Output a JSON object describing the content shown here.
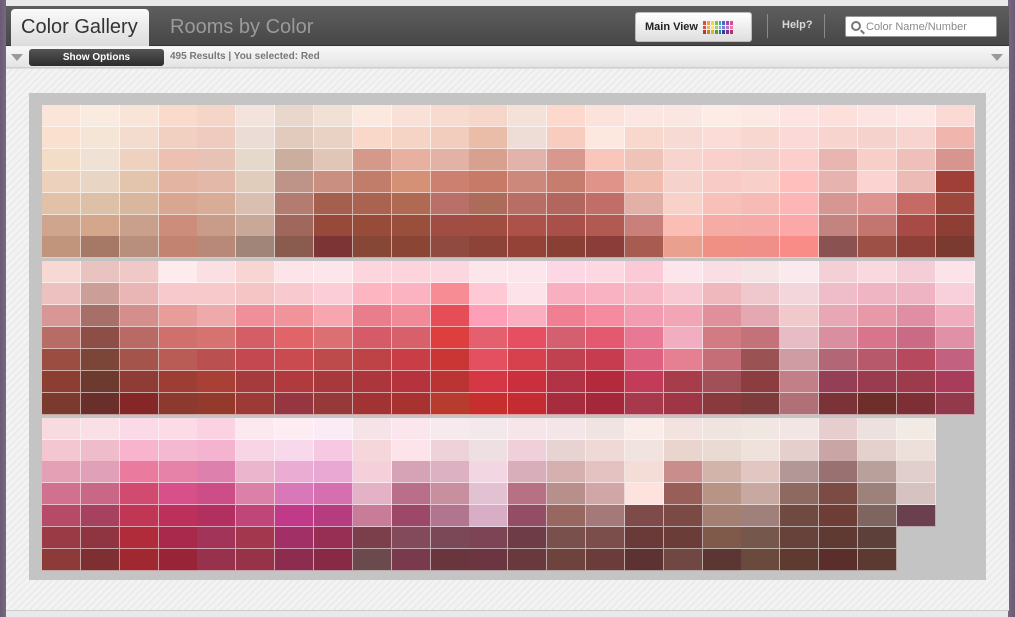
{
  "header": {
    "tabs": [
      {
        "label": "Color Gallery",
        "active": true
      },
      {
        "label": "Rooms by Color",
        "active": false
      }
    ],
    "main_view_label": "Main View",
    "help_label": "Help?",
    "search": {
      "value": "",
      "placeholder": "Color Name/Number"
    }
  },
  "options_bar": {
    "show_options_label": "Show Options",
    "status": "495 Results | You selected: Red"
  },
  "palette_icon_colors": [
    "#e8463a",
    "#f0a23a",
    "#f2d63c",
    "#7cc442",
    "#3aa0d8",
    "#5a5fc4",
    "#a04ab8",
    "#e04c8a",
    "#d8543a",
    "#e8b86a",
    "#f4e47a",
    "#9ad07a",
    "#6ab8e0",
    "#7a7ed0",
    "#b874c8",
    "#e87aa8",
    "#b83a2a",
    "#c8822a",
    "#d4b82a",
    "#5a9a32",
    "#2a78a8",
    "#3a3e94",
    "#783290",
    "#b03468"
  ],
  "swatch_groups": [
    {
      "rows": [
        [
          "#fbe4d8",
          "#f9ebdf",
          "#f8e5d8",
          "#f9dacb",
          "#f6d5c9",
          "#f2e3dc",
          "#e9d7cc",
          "#f0e0d5",
          "#fbe8df",
          "#fae1d8",
          "#f8dbcf",
          "#f5d6c9",
          "#f4e2d9",
          "#fdd8cc",
          "#fbe3dc",
          "#fbe6e1",
          "#fbe7e2",
          "#fdebe5",
          "#fce9e3",
          "#fde3e1",
          "#fde0dc",
          "#fbe4e1",
          "#fde7e4",
          "#fbdad5"
        ],
        [
          "#f9e0cf",
          "#f5e5d6",
          "#f3dccd",
          "#f2d0c1",
          "#efcbbf",
          "#ebddd5",
          "#e2cabc",
          "#e9d1c4",
          "#f9d8ca",
          "#f5d3c5",
          "#f2cdbd",
          "#e9bda8",
          "#eeddd6",
          "#f8ccbe",
          "#fde8e0",
          "#f8d8cc",
          "#f7dad3",
          "#fbdcd6",
          "#f8d7d0",
          "#fbd9d6",
          "#f8d4cf",
          "#f5d2cc",
          "#f8d4d0",
          "#f0b6ae"
        ],
        [
          "#f4ddc6",
          "#efe2d4",
          "#eed1be",
          "#ecc1b1",
          "#e9c2b6",
          "#e5d9cc",
          "#ccae9f",
          "#e1c5b6",
          "#d4998a",
          "#e7b0a0",
          "#e2b2a6",
          "#d7a08f",
          "#e2b3aa",
          "#d8988d",
          "#fac6bc",
          "#efc3b7",
          "#f8d4ce",
          "#f9d0cc",
          "#f5cfc9",
          "#fccfcc",
          "#e9b5b0",
          "#f8cec9",
          "#efc0b9",
          "#d89590"
        ],
        [
          "#ecd2bc",
          "#e9d5c3",
          "#e3c4ad",
          "#e4b4a3",
          "#e3b8a8",
          "#e0cdbb",
          "#bf9488",
          "#c98f80",
          "#c27d6a",
          "#d49176",
          "#cb8070",
          "#c77a67",
          "#cc897b",
          "#c77d6e",
          "#e09388",
          "#f0bcae",
          "#f5d2cb",
          "#f9cbc7",
          "#f8cfc9",
          "#ffbfbd",
          "#e7b3ae",
          "#fbd3d0",
          "#edbbb5",
          "#a03f38"
        ],
        [
          "#e2c1a9",
          "#dcc0a8",
          "#d9b79f",
          "#d9a691",
          "#d9ac98",
          "#d8bfaf",
          "#b37c70",
          "#a55f4e",
          "#a96350",
          "#b06952",
          "#b87068",
          "#ad6b5a",
          "#b86e65",
          "#b2665e",
          "#c06e67",
          "#e2b0a6",
          "#f8d2c8",
          "#f7c0b9",
          "#f7bbb6",
          "#fcb6b5",
          "#d69691",
          "#dd938f",
          "#c56a64",
          "#9d463c"
        ],
        [
          "#cfa58d",
          "#d4a78d",
          "#c9a08c",
          "#cc8e7a",
          "#c99c8a",
          "#c8a898",
          "#a0685c",
          "#974a3a",
          "#974c3a",
          "#9a4e3c",
          "#a04e44",
          "#a14d41",
          "#ac5248",
          "#aa504a",
          "#b05a52",
          "#c9807a",
          "#fbbeb5",
          "#f5aca5",
          "#f6aaa6",
          "#fca8a8",
          "#c3837f",
          "#c3756f",
          "#a84a46",
          "#8f3e35"
        ],
        [
          "#c0957c",
          "#a67966",
          "#b88e7c",
          "#c28371",
          "#b88879",
          "#a18578",
          "#8a5c4f",
          "#7c3534",
          "#864737",
          "#8a4535",
          "#914a3f",
          "#8e4338",
          "#944238",
          "#8a3f35",
          "#8b3d3a",
          "#a85b50",
          "#eaa08f",
          "#f08f84",
          "#f08f88",
          "#fa8c88",
          "#8b5252",
          "#9d5046",
          "#8e3f38",
          "#7a3a30"
        ]
      ],
      "skip": []
    },
    {
      "rows": [
        [
          "#f7d8d5",
          "#e9c3bf",
          "#f0c8c8",
          "#fdebee",
          "#fae0e2",
          "#f8d4d3",
          "#fde4e8",
          "#fce6ec",
          "#fdd5dc",
          "#fdd3dc",
          "#fdd7e0",
          "#fde5ec",
          "#fce6ec",
          "#fdd7e3",
          "#fdd7e1",
          "#fcc9d7",
          "#fce6ec",
          "#f9dfe3",
          "#f6e3e5",
          "#fae9ed",
          "#f5cfd6",
          "#f9d9df",
          "#f5cdd6",
          "#fbe3e9"
        ],
        [
          "#ecc1bf",
          "#cb9e98",
          "#e9b6b5",
          "#f8c9cc",
          "#f7c9ca",
          "#f5c4c4",
          "#f9c9d0",
          "#fbcdd7",
          "#fcb5c1",
          "#fbb2c1",
          "#f88c94",
          "#fec8d4",
          "#fde3e9",
          "#f8b0c0",
          "#f9b2c1",
          "#f8b9c7",
          "#f9c9d3",
          "#eeb8bc",
          "#efc8ce",
          "#f2d6db",
          "#efbcca",
          "#f0b5c3",
          "#efb4c4",
          "#f7d0dc"
        ],
        [
          "#d89794",
          "#a67068",
          "#d48f8c",
          "#e89d9b",
          "#eea9aa",
          "#f08f99",
          "#f0939a",
          "#f7a5ae",
          "#ea7d8b",
          "#f08a97",
          "#e64e57",
          "#ff9fb7",
          "#fbaec0",
          "#f07f91",
          "#f48b9e",
          "#f39bb0",
          "#f2a6b5",
          "#e0909b",
          "#e4a8b2",
          "#f1c8cb",
          "#e7a7b5",
          "#e899a8",
          "#e08ea3",
          "#f0adbd"
        ],
        [
          "#b86c66",
          "#8c4e46",
          "#b96a64",
          "#d0706d",
          "#d67371",
          "#d45e65",
          "#e16468",
          "#db6f72",
          "#d65b68",
          "#d8606b",
          "#dc3f3e",
          "#e4606e",
          "#e64f62",
          "#d45f6e",
          "#e35970",
          "#e87893",
          "#f0aec0",
          "#d27b83",
          "#c37279",
          "#e7bcc4",
          "#da8fa0",
          "#d8758c",
          "#cb6a84",
          "#e191a7"
        ],
        [
          "#9a4d40",
          "#7b4537",
          "#a4544b",
          "#b85c55",
          "#ba5050",
          "#c4484f",
          "#c94a4f",
          "#be4b4c",
          "#be4346",
          "#c93e46",
          "#ca3633",
          "#e4505f",
          "#d7404d",
          "#c04150",
          "#c73c4e",
          "#de6280",
          "#e58093",
          "#c56e78",
          "#9a5253",
          "#cf9ca3",
          "#b26676",
          "#b7596b",
          "#b7495f",
          "#c26180"
        ],
        [
          "#8c3e33",
          "#6d3a30",
          "#8f3c36",
          "#9d3e35",
          "#a84036",
          "#a63b3d",
          "#b03a3e",
          "#a7393d",
          "#ab373c",
          "#b5333d",
          "#bb3434",
          "#d53844",
          "#c92f3d",
          "#b33346",
          "#b22a3c",
          "#c23c5a",
          "#a73c4a",
          "#a25057",
          "#8b3d40",
          "#c37f88",
          "#953f56",
          "#993c50",
          "#9b3b4b",
          "#a93c5a"
        ],
        [
          "#7a3a2d",
          "#6a2f2a",
          "#862727",
          "#8c3a30",
          "#943a2d",
          "#9c3a37",
          "#963640",
          "#953a38",
          "#a23335",
          "#a73230",
          "#b73c2e",
          "#c72e2e",
          "#c42c31",
          "#a72c3e",
          "#a4283a",
          "#a8384c",
          "#9e3645",
          "#8a3a3d",
          "#7e3b3c",
          "#b07078",
          "#7b3338",
          "#6e2f2b",
          "#7e2f35",
          "#93394c"
        ]
      ],
      "skip": []
    },
    {
      "rows": [
        [
          "#f7dbe0",
          "#f8e0e6",
          "#fbd9e6",
          "#fcdbe6",
          "#fbd2e2",
          "#fbe9ef",
          "#fdecf2",
          "#fbebf4",
          "#f6e3e8",
          "#fbe6ed",
          "#f7eaee",
          "#f3e9ec",
          "#f6e6ea",
          "#f4e6e8",
          "#f0e4e2",
          "#f9ece9",
          "#f2e3e0",
          "#efe4df",
          "#f0e7e3",
          "#f2e6e4",
          "#e5cecd",
          "#ece1df",
          "#f2eae5"
        ],
        [
          "#f4c6d2",
          "#efbccc",
          "#f8b3cd",
          "#f5b8d1",
          "#f4b4d0",
          "#f7d5e4",
          "#f8d8eb",
          "#f6c8e2",
          "#f4d6db",
          "#fde4ea",
          "#eed2d9",
          "#eedfe3",
          "#efd0da",
          "#e8d3d3",
          "#efd9d7",
          "#f1e4e0",
          "#e9d5ce",
          "#e9dad3",
          "#efe2dc",
          "#e5cfcc",
          "#c9a5a5",
          "#e4d1cd",
          "#ede0da"
        ],
        [
          "#e4a1b5",
          "#e0a0b7",
          "#ea7b9f",
          "#e681a7",
          "#de80ad",
          "#eab5cd",
          "#ebacd4",
          "#e8a8d3",
          "#f5d0db",
          "#d6a2b5",
          "#dcb1c1",
          "#f2d6e2",
          "#d8aebb",
          "#d6b0ae",
          "#e3c2c1",
          "#f4dcd7",
          "#c98d8b",
          "#d3b4aa",
          "#e1c6c1",
          "#b39696",
          "#9a7171",
          "#b9a09b",
          "#e1cfcd"
        ],
        [
          "#d1718f",
          "#c96787",
          "#d14a6f",
          "#d8508a",
          "#cd4d86",
          "#db81a8",
          "#d978b8",
          "#d66fb0",
          "#e3b2c6",
          "#b96e8a",
          "#c8909f",
          "#e2c1d3",
          "#b77084",
          "#b8908b",
          "#d0a6a6",
          "#fde2de",
          "#985f58",
          "#b89487",
          "#c8a9a1",
          "#8e6960",
          "#7b4b44",
          "#9d827c",
          "#d6c2c0"
        ],
        [
          "#b74a66",
          "#a64260",
          "#c03756",
          "#bd305b",
          "#b23060",
          "#c0467a",
          "#c13a8a",
          "#b53c7f",
          "#c87c98",
          "#9e4869",
          "#b27590",
          "#d7aec6",
          "#934e66",
          "#98675f",
          "#a47979",
          "#7e4a4a",
          "#7b4a44",
          "#a48072",
          "#9f807a",
          "#6e4a40",
          "#6e3e36",
          "#7f6560",
          "#6a3f4e"
        ],
        [
          "#9a3a44",
          "#8f3542",
          "#b02c3a",
          "#a8294c",
          "#a2345a",
          "#a2374e",
          "#a13067",
          "#972f55",
          "#7a3f4b",
          "#834a5c",
          "#7b4858",
          "#7d4456",
          "#6e3c47",
          "#79504c",
          "#7b4d4b",
          "#6a3a38",
          "#6b3d39",
          "#7f5a4b",
          "#76574c",
          "#66423a",
          "#5e3a33",
          "#5e403a"
        ],
        [
          "#8c3a3a",
          "#7e2f32",
          "#a02830",
          "#982437",
          "#98324c",
          "#963348",
          "#8c2c4e",
          "#862a46",
          "#6b4a4d",
          "#7a3a4e",
          "#6a363e",
          "#6c3542",
          "#683a3e",
          "#6e433e",
          "#6a3d3a",
          "#5c3332",
          "#704742",
          "#5c3632",
          "#6a4a3c",
          "#5e3a31",
          "#5a2f2b",
          "#5c3a32"
        ]
      ],
      "skip": []
    }
  ]
}
